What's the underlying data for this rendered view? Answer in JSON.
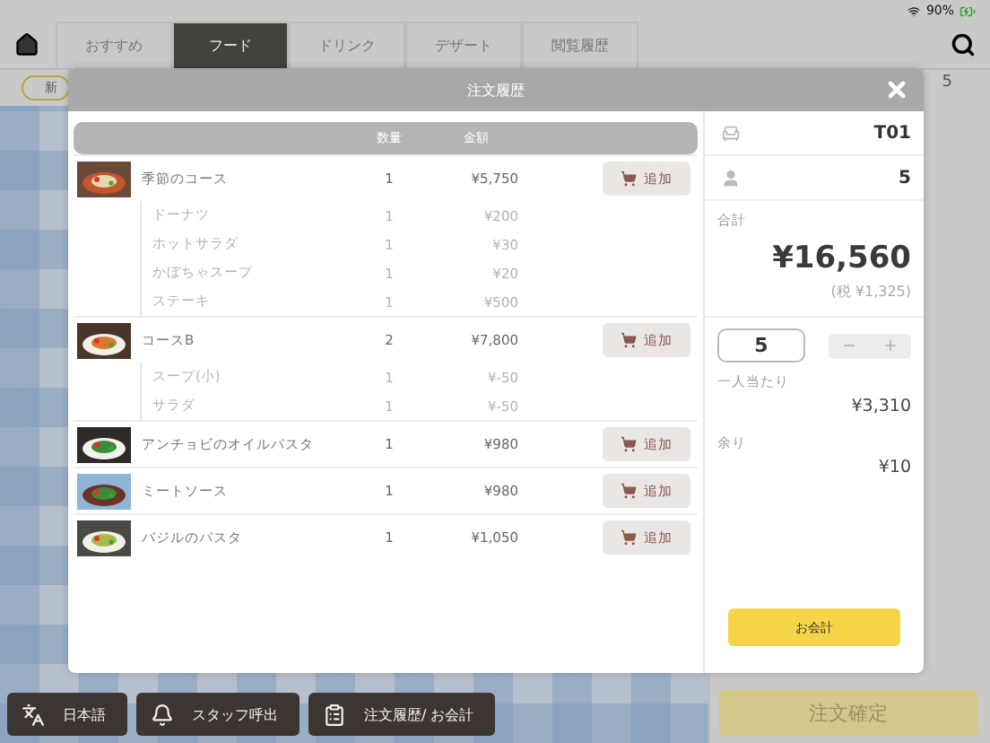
{
  "status_bar": {
    "battery": "90%"
  },
  "nav": {
    "tabs": [
      {
        "label": "おすすめ",
        "selected": false
      },
      {
        "label": "フード",
        "selected": true
      },
      {
        "label": "ドリンク",
        "selected": false
      },
      {
        "label": "デザート",
        "selected": false
      },
      {
        "label": "閲覧履歴",
        "selected": false
      }
    ]
  },
  "category_chip": "新",
  "header_count": "5",
  "modal": {
    "title": "注文履歴",
    "columns": [
      "数量",
      "金額"
    ],
    "items": [
      {
        "name": "季節のコース",
        "qty": "1",
        "price": "¥5,750",
        "add_label": "追加",
        "children": [
          {
            "name": "ドーナツ",
            "qty": "1",
            "price": "¥200"
          },
          {
            "name": "ホットサラダ",
            "qty": "1",
            "price": "¥30"
          },
          {
            "name": "かぼちゃスープ",
            "qty": "1",
            "price": "¥20"
          },
          {
            "name": "ステーキ",
            "qty": "1",
            "price": "¥500"
          }
        ]
      },
      {
        "name": "コースB",
        "qty": "2",
        "price": "¥7,800",
        "add_label": "追加",
        "children": [
          {
            "name": "スープ(小)",
            "qty": "1",
            "price": "¥-50"
          },
          {
            "name": "サラダ",
            "qty": "1",
            "price": "¥-50"
          }
        ]
      },
      {
        "name": "アンチョビのオイルパスタ",
        "qty": "1",
        "price": "¥980",
        "add_label": "追加"
      },
      {
        "name": "ミートソース",
        "qty": "1",
        "price": "¥980",
        "add_label": "追加"
      },
      {
        "name": "バジルのパスタ",
        "qty": "1",
        "price": "¥1,050",
        "add_label": "追加"
      }
    ],
    "summary": {
      "table": "T01",
      "guests": "5",
      "total_label": "合計",
      "total": "¥16,560",
      "tax": "(税 ¥1,325)",
      "split_count": "5",
      "per_person_label": "一人当たり",
      "per_person": "¥3,310",
      "remainder_label": "余り",
      "remainder": "¥10",
      "checkout": "お会計"
    }
  },
  "bottom_buttons": [
    {
      "label": "日本語",
      "kind": "language"
    },
    {
      "label": "スタッフ呼出",
      "kind": "staff"
    },
    {
      "label": "注文履歴/ お会計",
      "kind": "history"
    }
  ],
  "confirm_button": "注文確定"
}
